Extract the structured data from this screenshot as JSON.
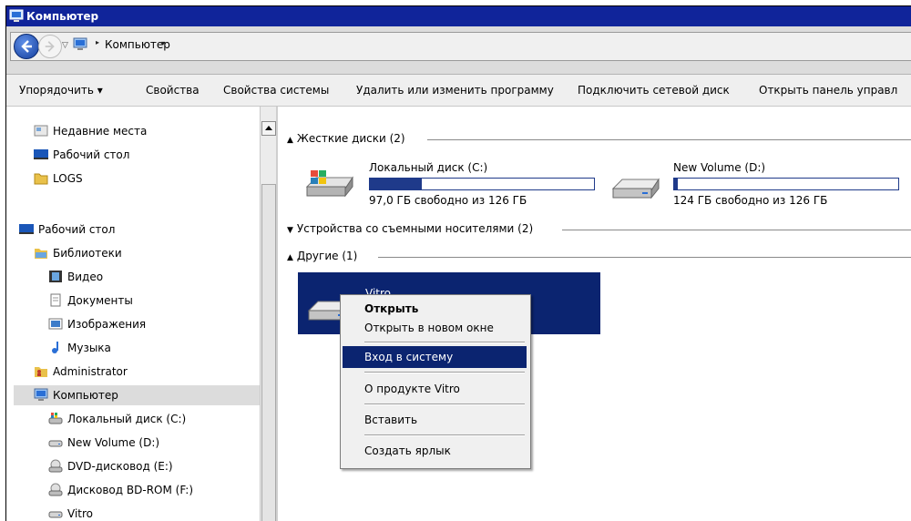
{
  "window": {
    "title": "Компьютер"
  },
  "address": {
    "path": "Компьютер"
  },
  "toolbar": {
    "items": [
      "Упорядочить ▾",
      "Свойства",
      "Свойства системы",
      "Удалить или изменить программу",
      "Подключить сетевой диск",
      "Открыть панель управл"
    ]
  },
  "nav": {
    "items": [
      {
        "label": "Недавние места",
        "icon": "recent-places-icon"
      },
      {
        "label": "Рабочий стол",
        "icon": "desktop-icon"
      },
      {
        "label": "LOGS",
        "icon": "folder-icon"
      },
      {
        "label": "Рабочий стол",
        "icon": "desktop-icon"
      },
      {
        "label": "Библиотеки",
        "icon": "libraries-icon"
      },
      {
        "label": "Видео",
        "icon": "video-icon"
      },
      {
        "label": "Документы",
        "icon": "documents-icon"
      },
      {
        "label": "Изображения",
        "icon": "pictures-icon"
      },
      {
        "label": "Музыка",
        "icon": "music-icon"
      },
      {
        "label": "Administrator",
        "icon": "user-folder-icon"
      },
      {
        "label": "Компьютер",
        "icon": "computer-icon"
      },
      {
        "label": "Локальный диск (C:)",
        "icon": "system-drive-icon"
      },
      {
        "label": "New Volume (D:)",
        "icon": "drive-icon"
      },
      {
        "label": "DVD-дисковод (E:)",
        "icon": "dvd-drive-icon"
      },
      {
        "label": "Дисковод BD-ROM (F:)",
        "icon": "bd-drive-icon"
      },
      {
        "label": "Vitro",
        "icon": "drive-icon"
      }
    ]
  },
  "groups": {
    "hard_disks": "Жесткие диски (2)",
    "removable": "Устройства со съемными носителями (2)",
    "other": "Другие (1)"
  },
  "drives": [
    {
      "name": "Локальный диск (C:)",
      "info": "97,0 ГБ свободно из 126 ГБ",
      "used_fraction": 0.23
    },
    {
      "name": "New Volume (D:)",
      "info": "124 ГБ свободно из 126 ГБ",
      "used_fraction": 0.016
    }
  ],
  "other_items": [
    {
      "name": "Vitro"
    }
  ],
  "context_menu": {
    "items": [
      "Открыть",
      "Открыть в новом окне",
      "Вход в систему",
      "О продукте Vitro",
      "Вставить",
      "Создать ярлык"
    ]
  },
  "colors": {
    "titlebar": "#10249a",
    "selection": "#0b2470",
    "bar_fill": "#1f3a8a"
  }
}
